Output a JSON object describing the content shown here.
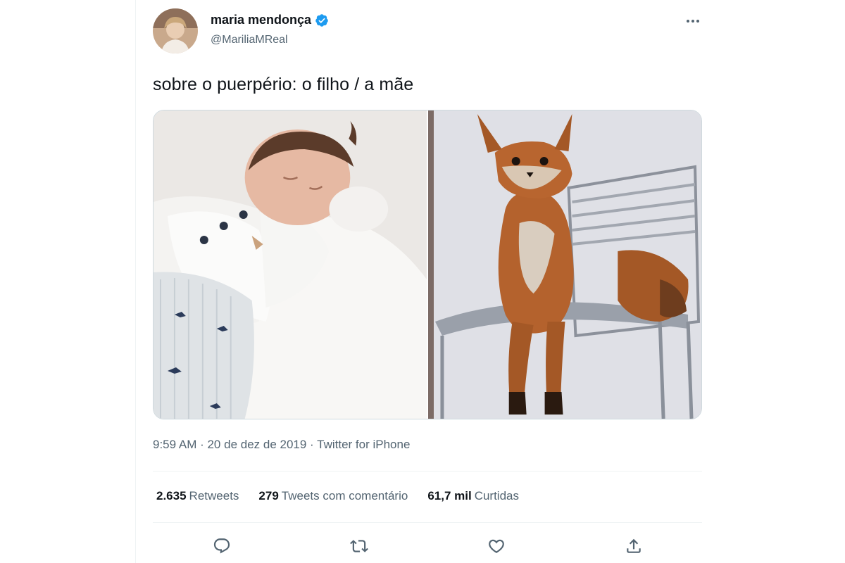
{
  "author": {
    "display_name": "maria mendonça",
    "handle": "@MariliaMReal",
    "verified": true,
    "verified_color": "#1d9bf0"
  },
  "tweet": {
    "text": "sobre o puerpério: o filho / a mãe",
    "timestamp": "9:59 AM · 20 de dez de 2019 · ",
    "source": "Twitter for iPhone"
  },
  "stats": {
    "retweets_count": "2.635",
    "retweets_label": "Retweets",
    "quotes_count": "279",
    "quotes_label": "Tweets com comentário",
    "likes_count": "61,7 mil",
    "likes_label": "Curtidas"
  },
  "icons": {
    "more": "more-horizontal-icon",
    "reply": "reply-icon",
    "retweet": "retweet-icon",
    "like": "heart-icon",
    "share": "share-icon"
  },
  "colors": {
    "text_primary": "#0f1419",
    "text_secondary": "#536471",
    "divider": "#eff3f4"
  }
}
